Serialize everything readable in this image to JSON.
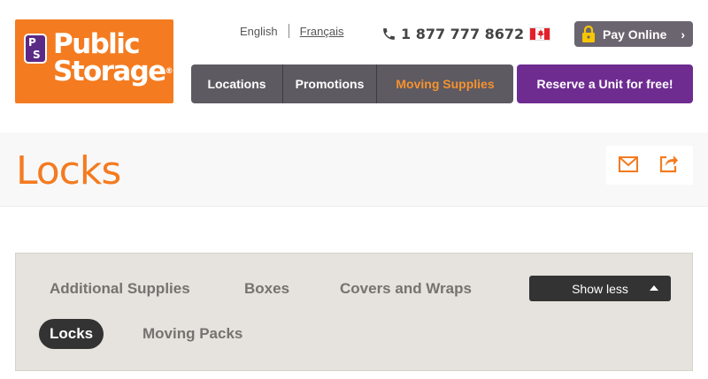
{
  "logo": {
    "badge_top": "P",
    "badge_bottom": "S",
    "line1": "Public",
    "line2": "Storage",
    "reg": "®"
  },
  "header": {
    "lang_english": "English",
    "lang_french": "Français",
    "phone": "1 877 777 8672",
    "pay_label": "Pay Online",
    "pay_chevron": "›"
  },
  "nav": {
    "items": [
      {
        "label": "Locations"
      },
      {
        "label": "Promotions"
      },
      {
        "label": "Moving Supplies",
        "active": true
      }
    ],
    "reserve_label": "Reserve a Unit for free!"
  },
  "page": {
    "title": "Locks"
  },
  "filters": {
    "chips": [
      {
        "label": "Additional Supplies"
      },
      {
        "label": "Boxes"
      },
      {
        "label": "Covers and Wraps"
      },
      {
        "label": "Locks",
        "active": true
      },
      {
        "label": "Moving Packs"
      }
    ],
    "toggle_label": "Show less"
  },
  "colors": {
    "brand_orange": "#f47b20",
    "brand_purple": "#6e2c91",
    "nav_gray": "#5e5a61",
    "nav_active": "#f5922f"
  },
  "icons": [
    "phone-icon",
    "canada-flag-icon",
    "lock-icon",
    "chevron-right-icon",
    "mail-icon",
    "share-icon",
    "caret-up-icon"
  ]
}
